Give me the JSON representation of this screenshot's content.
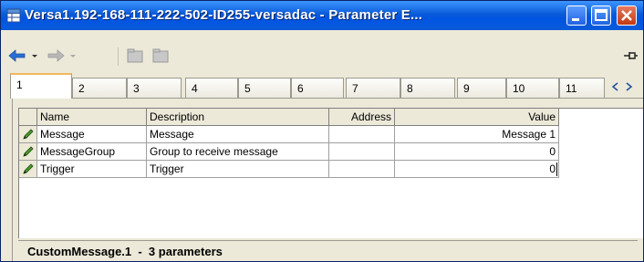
{
  "window": {
    "title": "Versa1.192-168-111-222-502-ID255-versadac - Parameter E...",
    "title_icon": "grid-icon",
    "titlebar_color": "#0a5bd8"
  },
  "toolbar": {
    "icons": [
      "back-arrow-icon",
      "forward-arrow-icon",
      "folder-icon",
      "folder-icon",
      "pin-icon"
    ]
  },
  "tabs": [
    "1",
    "2",
    "3",
    "4",
    "5",
    "6",
    "7",
    "8",
    "9",
    "10",
    "11"
  ],
  "active_tab": "1",
  "table": {
    "columns": [
      "Name",
      "Description",
      "Address",
      "Value"
    ],
    "rows": [
      {
        "icon": "pencil-icon",
        "name": "Message",
        "description": "Message",
        "address": "",
        "value": "Message 1"
      },
      {
        "icon": "pencil-icon",
        "name": "MessageGroup",
        "description": "Group to receive message",
        "address": "",
        "value": "0"
      },
      {
        "icon": "pencil-icon",
        "name": "Trigger",
        "description": "Trigger",
        "address": "",
        "value": "0"
      }
    ]
  },
  "status": "CustomMessage.1  -  3 parameters"
}
